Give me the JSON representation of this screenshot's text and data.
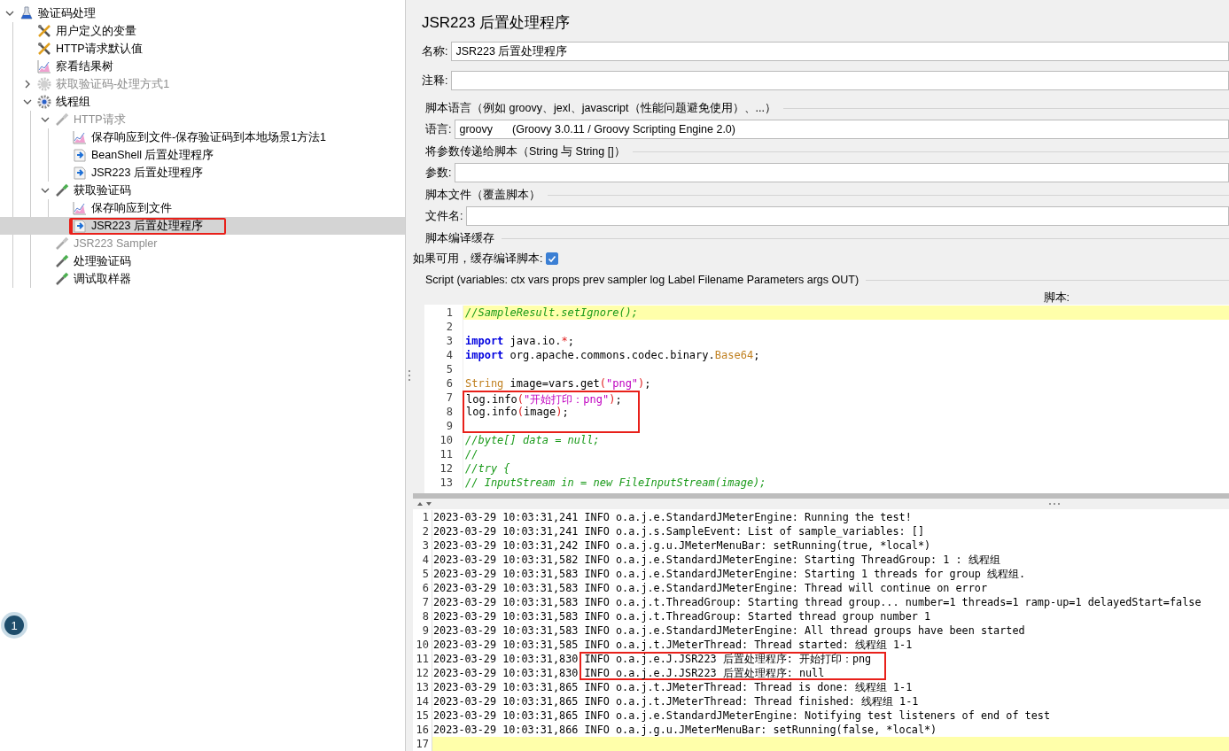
{
  "tree": [
    {
      "label": "验证码处理",
      "kind": "flask",
      "expanded": true,
      "selected": false,
      "disabled": false,
      "boxed": false,
      "children": [
        {
          "label": "用户定义的变量",
          "kind": "tools",
          "selected": false,
          "disabled": false,
          "boxed": false
        },
        {
          "label": "HTTP请求默认值",
          "kind": "tools",
          "selected": false,
          "disabled": false,
          "boxed": false
        },
        {
          "label": "察看结果树",
          "kind": "graph",
          "selected": false,
          "disabled": false,
          "boxed": false
        },
        {
          "label": "获取验证码-处理方式1",
          "kind": "gear",
          "expanded": false,
          "selected": false,
          "disabled": true,
          "boxed": false
        },
        {
          "label": "线程组",
          "kind": "threadgroup",
          "expanded": true,
          "selected": false,
          "disabled": false,
          "boxed": false,
          "children": [
            {
              "label": "HTTP请求",
              "kind": "pipette",
              "expanded": true,
              "selected": false,
              "disabled": true,
              "boxed": false,
              "children": [
                {
                  "label": "保存响应到文件-保存验证码到本地场景1方法1",
                  "kind": "graph",
                  "selected": false,
                  "disabled": false,
                  "boxed": false
                },
                {
                  "label": "BeanShell 后置处理程序",
                  "kind": "post",
                  "selected": false,
                  "disabled": false,
                  "boxed": false
                },
                {
                  "label": "JSR223 后置处理程序",
                  "kind": "post",
                  "selected": false,
                  "disabled": false,
                  "boxed": false
                }
              ]
            },
            {
              "label": "获取验证码",
              "kind": "pipette",
              "expanded": true,
              "selected": false,
              "disabled": false,
              "boxed": false,
              "children": [
                {
                  "label": "保存响应到文件",
                  "kind": "graph",
                  "selected": false,
                  "disabled": false,
                  "boxed": false
                },
                {
                  "label": "JSR223 后置处理程序",
                  "kind": "post",
                  "selected": true,
                  "disabled": false,
                  "boxed": true
                }
              ]
            },
            {
              "label": "JSR223 Sampler",
              "kind": "pipette",
              "selected": false,
              "disabled": true,
              "boxed": false
            },
            {
              "label": "处理验证码",
              "kind": "pipette",
              "selected": false,
              "disabled": false,
              "boxed": false
            },
            {
              "label": "调试取样器",
              "kind": "pipette",
              "selected": false,
              "disabled": false,
              "boxed": false
            }
          ]
        }
      ]
    }
  ],
  "badge": "1",
  "panel": {
    "title": "JSR223 后置处理程序",
    "name": {
      "label": "名称:",
      "value": "JSR223 后置处理程序"
    },
    "comment": {
      "label": "注释:"
    },
    "language_section": "脚本语言（例如 groovy、jexl、javascript（性能问题避免使用）、...）",
    "language": {
      "label": "语言:",
      "value": "groovy",
      "description": "(Groovy 3.0.11 / Groovy Scripting Engine 2.0)"
    },
    "params_section": "将参数传递给脚本（String 与 String []）",
    "params": {
      "label": "参数:"
    },
    "file_section": "脚本文件（覆盖脚本）",
    "file": {
      "label": "文件名:"
    },
    "cache_section": "脚本编译缓存",
    "cache": {
      "label": "如果可用，缓存编译脚本:",
      "checked": true
    },
    "script_section": "Script (variables: ctx vars props prev sampler log Label Filename Parameters args OUT)",
    "script_label": "脚本:"
  },
  "code": [
    {
      "number": "1",
      "current": true,
      "boxed": false,
      "tokens": [
        {
          "kind": "comment",
          "text": "//SampleResult.setIgnore();"
        }
      ]
    },
    {
      "number": "2",
      "current": false,
      "boxed": false
    },
    {
      "number": "3",
      "current": false,
      "boxed": false,
      "tokens": [
        {
          "kind": "keyword",
          "text": "import"
        },
        {
          "kind": "plain",
          "text": " java.io."
        },
        {
          "kind": "paren",
          "text": "*"
        },
        {
          "kind": "plain",
          "text": ";"
        }
      ]
    },
    {
      "number": "4",
      "current": false,
      "boxed": false,
      "tokens": [
        {
          "kind": "keyword",
          "text": "import"
        },
        {
          "kind": "plain",
          "text": " org.apache.commons.codec.binary."
        },
        {
          "kind": "type",
          "text": "Base64"
        },
        {
          "kind": "plain",
          "text": ";"
        }
      ]
    },
    {
      "number": "5",
      "current": false,
      "boxed": false
    },
    {
      "number": "6",
      "current": false,
      "boxed": false,
      "tokens": [
        {
          "kind": "type",
          "text": "String"
        },
        {
          "kind": "plain",
          "text": " image=vars.get"
        },
        {
          "kind": "paren",
          "text": "("
        },
        {
          "kind": "string",
          "text": "\"png\""
        },
        {
          "kind": "paren",
          "text": ")"
        },
        {
          "kind": "plain",
          "text": ";"
        }
      ]
    },
    {
      "number": "7",
      "current": false,
      "boxed": true,
      "tokens": [
        {
          "kind": "plain",
          "text": "log.info"
        },
        {
          "kind": "paren",
          "text": "("
        },
        {
          "kind": "string",
          "text": "\"开始打印：png\""
        },
        {
          "kind": "paren",
          "text": ")"
        },
        {
          "kind": "plain",
          "text": ";"
        }
      ]
    },
    {
      "number": "8",
      "current": false,
      "boxed": true,
      "tokens": [
        {
          "kind": "plain",
          "text": "log.info"
        },
        {
          "kind": "paren",
          "text": "("
        },
        {
          "kind": "plain",
          "text": "image"
        },
        {
          "kind": "paren",
          "text": ")"
        },
        {
          "kind": "plain",
          "text": ";"
        }
      ]
    },
    {
      "number": "9",
      "current": false,
      "boxed": true
    },
    {
      "number": "10",
      "current": false,
      "boxed": false,
      "tokens": [
        {
          "kind": "comment",
          "text": "//byte[] data = null;"
        }
      ]
    },
    {
      "number": "11",
      "current": false,
      "boxed": false,
      "tokens": [
        {
          "kind": "comment",
          "text": "//"
        }
      ]
    },
    {
      "number": "12",
      "current": false,
      "boxed": false,
      "tokens": [
        {
          "kind": "comment",
          "text": "//try {"
        }
      ]
    },
    {
      "number": "13",
      "current": false,
      "boxed": false,
      "tokens": [
        {
          "kind": "comment",
          "text": "//   InputStream in = new FileInputStream(image);"
        }
      ]
    }
  ],
  "log": [
    {
      "number": "1",
      "current": false,
      "boxed": false,
      "text": "2023-03-29 10:03:31,241 INFO o.a.j.e.StandardJMeterEngine: Running the test!"
    },
    {
      "number": "2",
      "current": false,
      "boxed": false,
      "text": "2023-03-29 10:03:31,241 INFO o.a.j.s.SampleEvent: List of sample_variables: []"
    },
    {
      "number": "3",
      "current": false,
      "boxed": false,
      "text": "2023-03-29 10:03:31,242 INFO o.a.j.g.u.JMeterMenuBar: setRunning(true, *local*)"
    },
    {
      "number": "4",
      "current": false,
      "boxed": false,
      "text": "2023-03-29 10:03:31,582 INFO o.a.j.e.StandardJMeterEngine: Starting ThreadGroup: 1 : 线程组"
    },
    {
      "number": "5",
      "current": false,
      "boxed": false,
      "text": "2023-03-29 10:03:31,583 INFO o.a.j.e.StandardJMeterEngine: Starting 1 threads for group 线程组."
    },
    {
      "number": "6",
      "current": false,
      "boxed": false,
      "text": "2023-03-29 10:03:31,583 INFO o.a.j.e.StandardJMeterEngine: Thread will continue on error"
    },
    {
      "number": "7",
      "current": false,
      "boxed": false,
      "text": "2023-03-29 10:03:31,583 INFO o.a.j.t.ThreadGroup: Starting thread group... number=1 threads=1 ramp-up=1 delayedStart=false"
    },
    {
      "number": "8",
      "current": false,
      "boxed": false,
      "text": "2023-03-29 10:03:31,583 INFO o.a.j.t.ThreadGroup: Started thread group number 1"
    },
    {
      "number": "9",
      "current": false,
      "boxed": false,
      "text": "2023-03-29 10:03:31,583 INFO o.a.j.e.StandardJMeterEngine: All thread groups have been started"
    },
    {
      "number": "10",
      "current": false,
      "boxed": false,
      "text": "2023-03-29 10:03:31,585 INFO o.a.j.t.JMeterThread: Thread started: 线程组 1-1"
    },
    {
      "number": "11",
      "current": false,
      "boxed": true,
      "text": "2023-03-29 10:03:31,830 INFO o.a.j.e.J.JSR223 后置处理程序: 开始打印：png"
    },
    {
      "number": "12",
      "current": false,
      "boxed": true,
      "text": "2023-03-29 10:03:31,830 INFO o.a.j.e.J.JSR223 后置处理程序: null"
    },
    {
      "number": "13",
      "current": false,
      "boxed": false,
      "text": "2023-03-29 10:03:31,865 INFO o.a.j.t.JMeterThread: Thread is done: 线程组 1-1"
    },
    {
      "number": "14",
      "current": false,
      "boxed": false,
      "text": "2023-03-29 10:03:31,865 INFO o.a.j.t.JMeterThread: Thread finished: 线程组 1-1"
    },
    {
      "number": "15",
      "current": false,
      "boxed": false,
      "text": "2023-03-29 10:03:31,865 INFO o.a.j.e.StandardJMeterEngine: Notifying test listeners of end of test"
    },
    {
      "number": "16",
      "current": false,
      "boxed": false,
      "text": "2023-03-29 10:03:31,866 INFO o.a.j.g.u.JMeterMenuBar: setRunning(false, *local*)"
    },
    {
      "number": "17",
      "current": true,
      "boxed": false
    }
  ]
}
